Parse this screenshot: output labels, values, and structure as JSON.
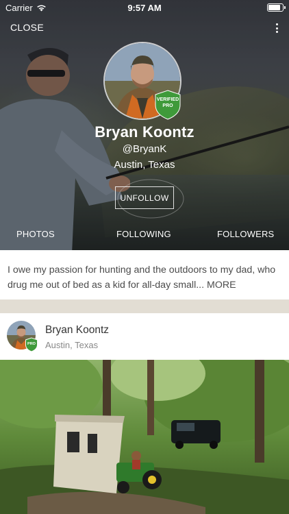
{
  "status_bar": {
    "carrier": "Carrier",
    "time": "9:57 AM",
    "wifi_icon": "wifi-icon",
    "battery_icon": "battery-icon"
  },
  "nav": {
    "close_label": "CLOSE",
    "more_icon": "more-vertical-icon"
  },
  "profile": {
    "name": "Bryan Koontz",
    "handle": "@BryanK",
    "location": "Austin, Texas",
    "badge_line1": "VERIFIED",
    "badge_line2": "PRO",
    "unfollow_label": "UNFOLLOW"
  },
  "tabs": [
    {
      "label": "PHOTOS"
    },
    {
      "label": "FOLLOWING"
    },
    {
      "label": "FOLLOWERS"
    }
  ],
  "bio": {
    "text": "I owe my passion for hunting and the outdoors to my dad, who drug me out of bed as a kid for all-day small...",
    "more_label": "MORE"
  },
  "post": {
    "author_name": "Bryan Koontz",
    "author_location": "Austin, Texas",
    "badge_label": "PRO"
  },
  "colors": {
    "badge_green": "#3f9a3a",
    "separator": "#e2ddd3",
    "bio_text": "#4b4b4b",
    "post_location": "#888888"
  }
}
